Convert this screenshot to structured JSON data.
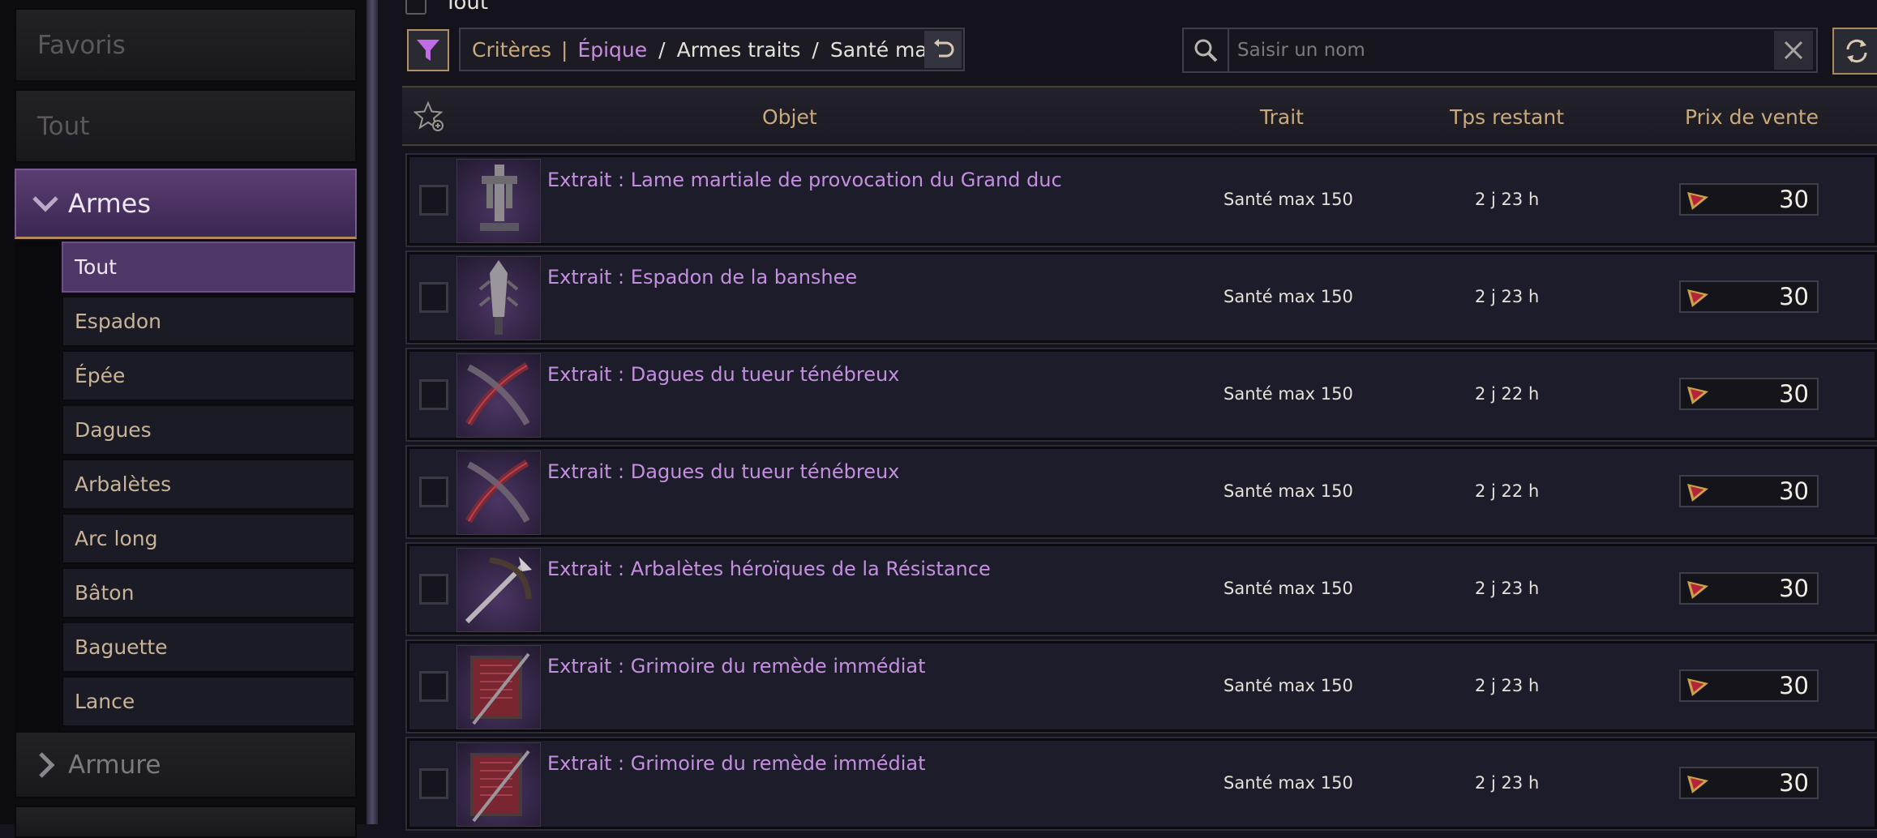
{
  "sidebar": {
    "favorites": "Favoris",
    "all": "Tout",
    "armes": "Armes",
    "sub_items": [
      "Tout",
      "Espadon",
      "Épée",
      "Dagues",
      "Arbalètes",
      "Arc long",
      "Bâton",
      "Baguette",
      "Lance"
    ],
    "armure": "Armure"
  },
  "breadcrumb": "Tout",
  "criteria": {
    "label": "Critères",
    "rarity": "Épique",
    "category": "Armes traits",
    "trait": "Santé max"
  },
  "search": {
    "placeholder": "Saisir un nom"
  },
  "table": {
    "headers": {
      "object": "Objet",
      "trait": "Trait",
      "time": "Tps restant",
      "price": "Prix de vente"
    },
    "rows": [
      {
        "name": "Extrait : Lame martiale de provocation du Grand duc",
        "trait": "Santé max 150",
        "time": "2 j 23 h",
        "price": "30",
        "thumb": "sword-icon"
      },
      {
        "name": "Extrait : Espadon de la banshee",
        "trait": "Santé max 150",
        "time": "2 j 23 h",
        "price": "30",
        "thumb": "greatsword-icon"
      },
      {
        "name": "Extrait : Dagues du tueur ténébreux",
        "trait": "Santé max 150",
        "time": "2 j 22 h",
        "price": "30",
        "thumb": "daggers-icon"
      },
      {
        "name": "Extrait : Dagues du tueur ténébreux",
        "trait": "Santé max 150",
        "time": "2 j 22 h",
        "price": "30",
        "thumb": "daggers-icon"
      },
      {
        "name": "Extrait : Arbalètes héroïques de la Résistance",
        "trait": "Santé max 150",
        "time": "2 j 23 h",
        "price": "30",
        "thumb": "crossbow-icon"
      },
      {
        "name": "Extrait : Grimoire du remède immédiat",
        "trait": "Santé max 150",
        "time": "2 j 23 h",
        "price": "30",
        "thumb": "grimoire-icon"
      },
      {
        "name": "Extrait : Grimoire du remède immédiat",
        "trait": "Santé max 150",
        "time": "2 j 23 h",
        "price": "30",
        "thumb": "grimoire-icon"
      }
    ]
  },
  "colors": {
    "accent_purple": "#c58fe0",
    "gold": "#c9aa7c",
    "active_bg": "#4f3868"
  }
}
